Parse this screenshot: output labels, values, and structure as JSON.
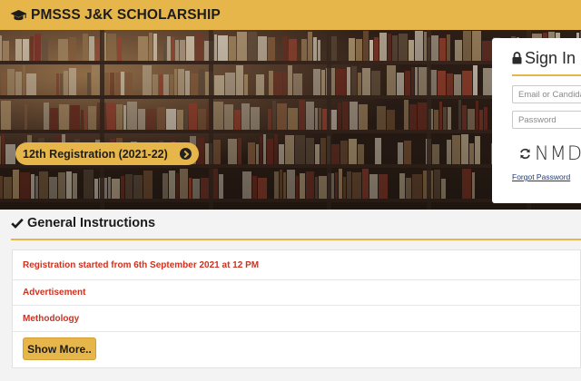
{
  "app": {
    "title": "PMSSS J&K SCHOLARSHIP",
    "accent_color": "#e7b64a",
    "logo_icon": "graduation-cap-icon"
  },
  "hero": {
    "registration_label": "12th Registration (2021-22)",
    "registration_icon": "chevron-circle-right-icon"
  },
  "signin": {
    "title": "Sign In",
    "title_icon": "lock-icon",
    "email_placeholder": "Email or Candidate ID",
    "password_placeholder": "Password",
    "refresh_icon": "refresh-icon",
    "captcha_text": "NMD",
    "forgot_label": "Forgot Password"
  },
  "instructions": {
    "heading": "General Instructions",
    "heading_icon": "check-icon",
    "items": [
      "Registration started from 6th September 2021 at 12 PM",
      "Advertisement",
      "Methodology"
    ],
    "item_color": "#d0311f",
    "show_more_label": "Show More.."
  }
}
